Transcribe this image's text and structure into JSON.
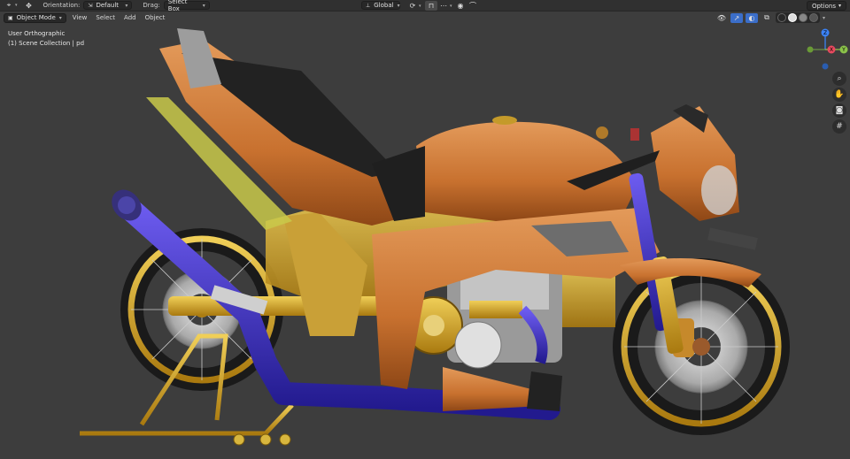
{
  "toolbar": {
    "orientation_label": "Orientation:",
    "orientation_value": "Default",
    "drag_label": "Drag:",
    "drag_value": "Select Box",
    "transform_orientation": "Global",
    "options_label": "Options"
  },
  "header": {
    "mode": "Object Mode",
    "menu": [
      "View",
      "Select",
      "Add",
      "Object"
    ]
  },
  "viewport": {
    "view_name": "User Orthographic",
    "collection": "(1) Scene Collection | pd"
  },
  "gizmo": {
    "x_label": "X",
    "y_label": "Y",
    "z_label": "Z"
  },
  "icons": {
    "cursor_tool": "cursor-icon",
    "move_tool": "move-icon",
    "zoom": "zoom-icon",
    "pan": "hand-icon",
    "camera": "camera-icon",
    "grid": "grid-icon"
  },
  "colors": {
    "background": "#3d3d3d",
    "header": "#303030",
    "axis_x": "#e84a5f",
    "axis_y": "#8bc34a",
    "axis_z": "#3b82f6",
    "body_orange": "#d2803f",
    "frame_gold": "#d4a82a",
    "pipe_blue": "#3d2fbf"
  }
}
